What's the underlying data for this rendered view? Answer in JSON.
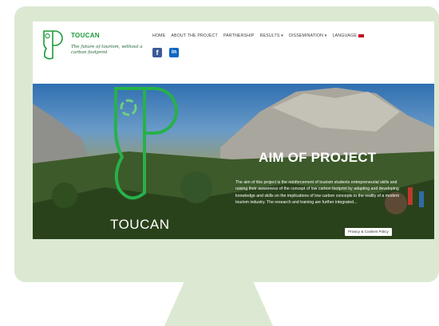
{
  "site": {
    "brand": "TOUCAN",
    "tagline": "The future of tourism, without a carbon footprint",
    "nav": [
      "HOME",
      "ABOUT THE PROJECT",
      "PARTNERSHIP",
      "RESULTS ▾",
      "DISSEMINATION ▾",
      "LANGUAGE"
    ],
    "social": {
      "facebook": "f",
      "linkedin": "in"
    }
  },
  "hero": {
    "brand": "TOUCAN",
    "title": "AIM OF PROJECT",
    "text": "The aim of this project is the reinforcement of tourism students entrepreneurial skills and raising their awareness of the concept of low carbon footprint by adapting and developing knowledge and skills on the implications of low carbon concepts to the reality of a modern tourism industry. The research and training are further integrated...",
    "cookie": "Privacy & Cookies Policy"
  },
  "colors": {
    "frame": "#dbe9d2",
    "brand_green": "#1d9a3a"
  }
}
